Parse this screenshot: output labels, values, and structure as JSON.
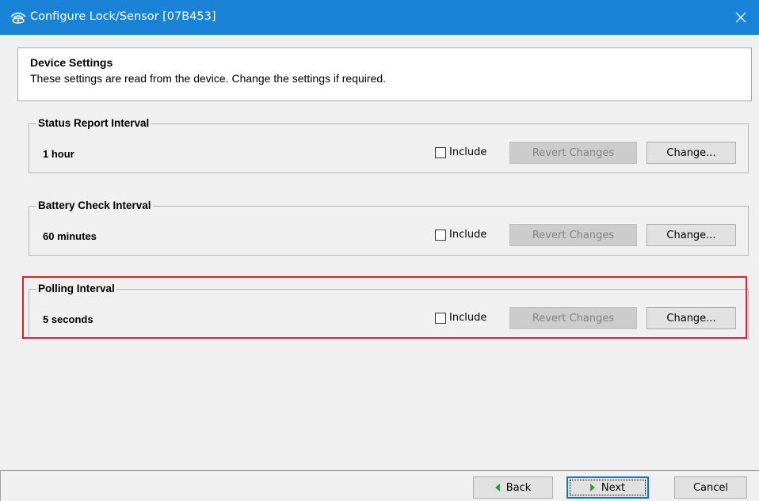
{
  "window": {
    "title": "Configure Lock/Sensor [07B453]",
    "icon": "wireless-signal-icon",
    "accent": "#1883d7"
  },
  "header": {
    "title": "Device Settings",
    "subtitle": "These settings are read from the device. Change the settings if required."
  },
  "groups": [
    {
      "label": "Status Report Interval",
      "value": "1 hour",
      "include_label": "Include",
      "include_checked": false,
      "revert_label": "Revert Changes",
      "change_label": "Change..."
    },
    {
      "label": "Battery Check Interval",
      "value": "60 minutes",
      "include_label": "Include",
      "include_checked": false,
      "revert_label": "Revert Changes",
      "change_label": "Change..."
    },
    {
      "label": "Polling Interval",
      "value": "5 seconds",
      "include_label": "Include",
      "include_checked": false,
      "revert_label": "Revert Changes",
      "change_label": "Change..."
    }
  ],
  "highlight_color": "#e0202a",
  "footer": {
    "back_label": "Back",
    "next_label": "Next",
    "cancel_label": "Cancel"
  }
}
